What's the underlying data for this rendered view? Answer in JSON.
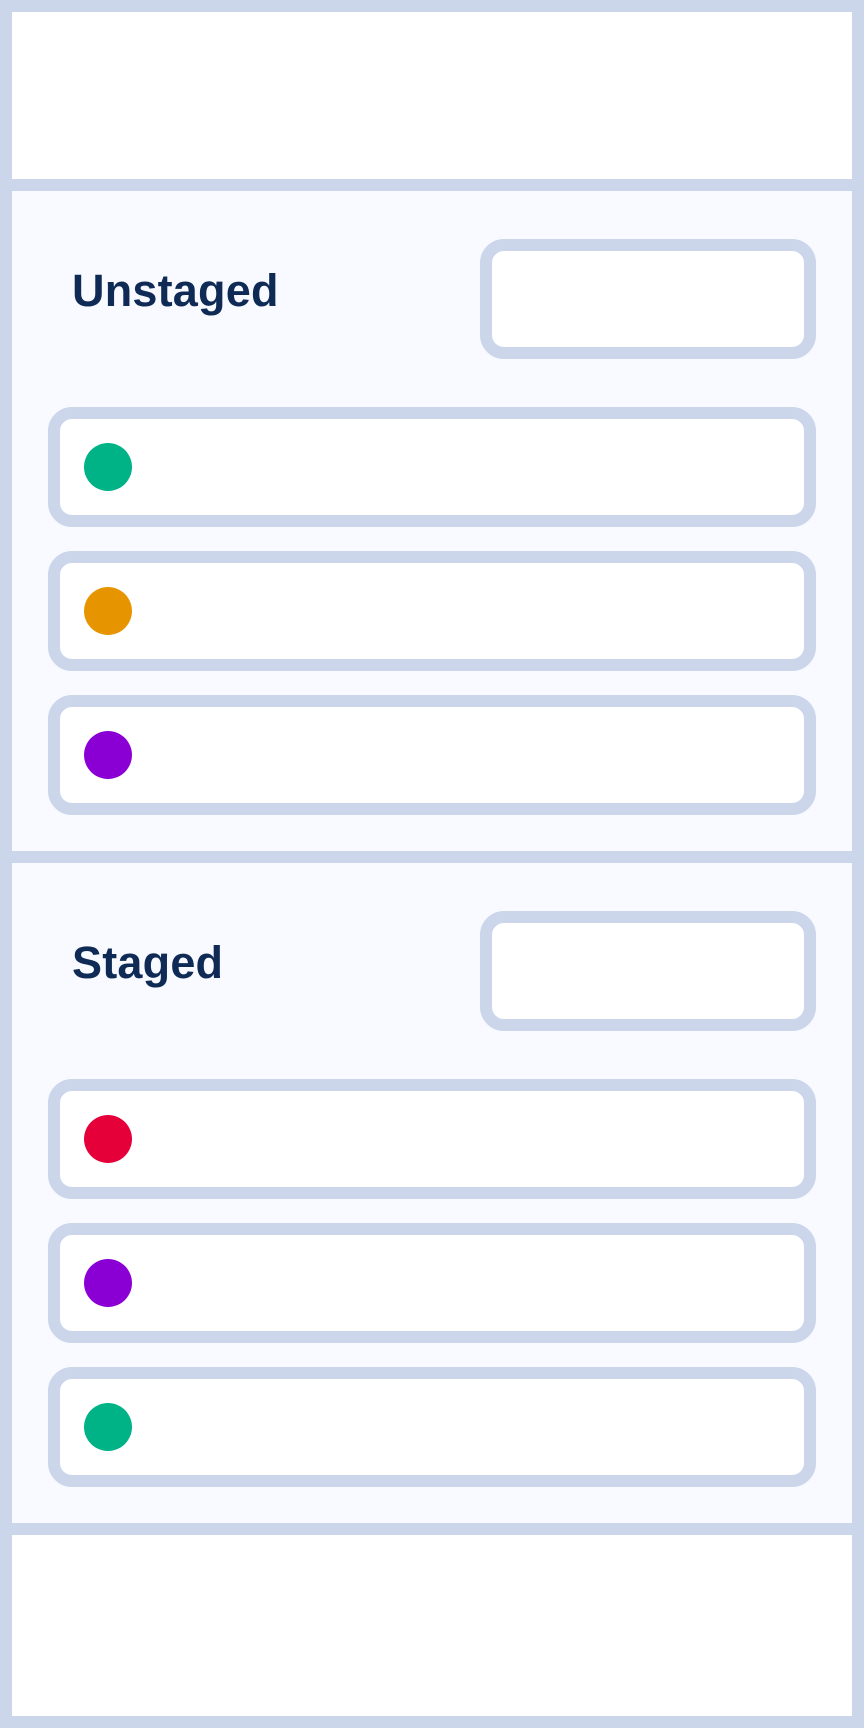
{
  "colors": {
    "border": "#ccd6ea",
    "section_background": "#f8faff",
    "title": "#102a56",
    "added": "#00b386",
    "modified": "#e69500",
    "renamed": "#8a00d4",
    "deleted": "#e6003a"
  },
  "unstaged": {
    "title": "Unstaged",
    "action_label": "",
    "files": [
      {
        "name": "",
        "status_color": "#00b386"
      },
      {
        "name": "",
        "status_color": "#e69500"
      },
      {
        "name": "",
        "status_color": "#8a00d4"
      }
    ]
  },
  "staged": {
    "title": "Staged",
    "action_label": "",
    "files": [
      {
        "name": "",
        "status_color": "#e6003a"
      },
      {
        "name": "",
        "status_color": "#8a00d4"
      },
      {
        "name": "",
        "status_color": "#00b386"
      }
    ]
  }
}
